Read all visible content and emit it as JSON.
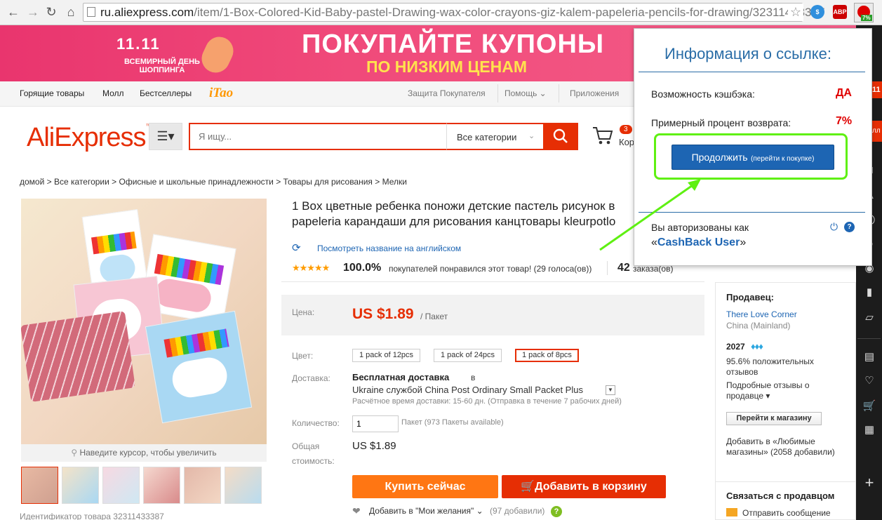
{
  "browser": {
    "url_domain": "ru.aliexpress.com",
    "url_path": "/item/1-Box-Colored-Kid-Baby-pastel-Drawing-wax-color-crayons-giz-kalem-papeleria-pencils-for-drawing/32311433387",
    "ext_abp": "ABP",
    "ext_badge": "7%"
  },
  "banner": {
    "event": "11.11",
    "event_sub": "ВСЕМИРНЫЙ ДЕНЬ ШОППИНГА",
    "headline": "ПОКУПАЙТЕ КУПОНЫ",
    "subline": "ПО НИЗКИМ ЦЕНАМ"
  },
  "topnav": {
    "left": [
      "Горящие товары",
      "Молл",
      "Бестселлеры"
    ],
    "itao": "iTao",
    "right": [
      "Защита Покупателя",
      "Помощь ⌄",
      "Приложения"
    ]
  },
  "header": {
    "logo": "AliExpress",
    "logo_tm": "™",
    "search_placeholder": "Я ищу...",
    "category": "Все категории",
    "cart_count": "3",
    "cart_label": "Кор"
  },
  "breadcrumb": "домой > Все категории > Офисные и школьные принадлежности > Товары для рисования > Мелки",
  "gallery": {
    "zoom_hint": "Наведите курсор, чтобы увеличить",
    "product_id": "Идентификатор товара 32311433387"
  },
  "product": {
    "title": "1 Box цветные ребенка поножи детские пастель рисунок в papeleria карандаши для рисования канцтовары kleurpotlo",
    "translate_link": "Посмотреть название на английском",
    "rating_percent": "100.0%",
    "rating_text": "покупателей понравился этот товар! (29 голоса(ов))",
    "orders": "42",
    "orders_label": "заказа(ов)",
    "price_label": "Цена:",
    "price": "US $1.89",
    "price_unit": "/ Пакет",
    "color_label": "Цвет:",
    "color_options": [
      "1 pack of 12pcs",
      "1 pack of 24pcs",
      "1 pack of 8pcs"
    ],
    "color_selected": 2,
    "shipping_label": "Доставка:",
    "shipping_free": "Бесплатная доставка",
    "shipping_in": "в",
    "shipping_method": "Ukraine службой China Post Ordinary Small Packet Plus",
    "shipping_estimate": "Расчётное время доставки: 15-60 дн. (Отправка в течение 7 рабочих дней)",
    "qty_label": "Количество:",
    "qty_value": "1",
    "qty_info": "Пакет (973 Пакеты available)",
    "total_label_1": "Общая",
    "total_label_2": "стоимость:",
    "total": "US $1.89",
    "buy_now": "Купить сейчас",
    "add_to_cart": "Добавить в корзину",
    "wishlist": "Добавить в \"Мои желания\" ⌄",
    "wishlist_count": "(97 добавили)"
  },
  "seller": {
    "heading": "Продавец:",
    "name": "There Love Corner",
    "country": "China (Mainland)",
    "score": "2027",
    "positive": "95.6% положительных",
    "positive_2": "отзывов",
    "detailed_1": "Подробные отзывы о",
    "detailed_2": "продавце ▾",
    "goto_store": "Перейти к магазину",
    "fav_1": "Добавить в «Любимые",
    "fav_2": "магазины» (2058 добавили)",
    "contact": "Связаться с продавцом",
    "send_message": "Отправить сообщение"
  },
  "popup": {
    "title": "Информация о ссылке:",
    "cashback_label": "Возможность кэшбэка:",
    "cashback_value": "ДА",
    "percent_label": "Примерный процент возврата:",
    "percent_value": "7%",
    "continue_main": "Продолжить",
    "continue_sub": "(перейти к покупке)",
    "auth_text": "Вы авторизованы как",
    "user_prefix": "«",
    "user_name": "CashBack User",
    "user_suffix": "»"
  },
  "sidebar_edge": {
    "tag": "11",
    "label": "лл"
  },
  "colors": {
    "accent": "#e62e04",
    "buy_orange": "#ff7613",
    "popup_blue": "#1d65b3",
    "highlight_green": "#5ff012"
  }
}
